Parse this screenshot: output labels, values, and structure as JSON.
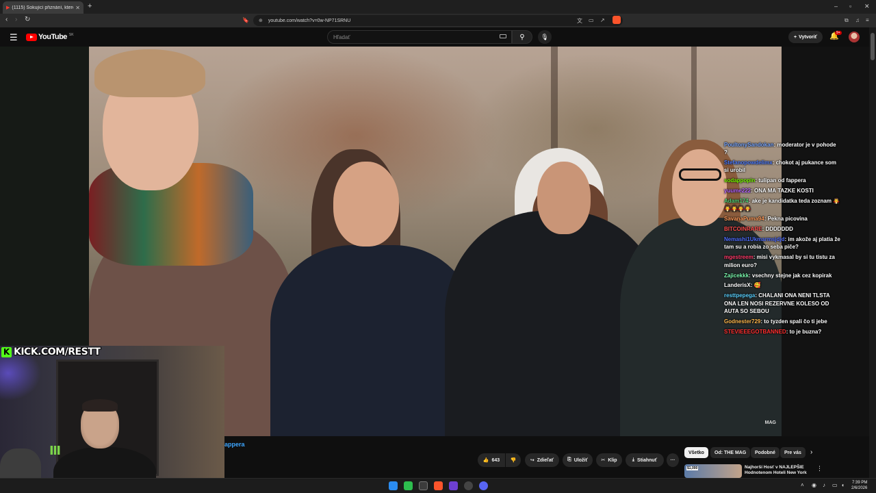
{
  "browser": {
    "tab_title": "(1115) Šokující přiznání, které",
    "new_tab": "+",
    "url": "youtube.com/watch?v=0w-NP71SRNU",
    "window_controls": [
      "–",
      "▫",
      "✕"
    ]
  },
  "youtube": {
    "logo_text": "YouTube",
    "country_code": "SK",
    "search_placeholder": "Hľadať",
    "create_label": "Vytvoriť",
    "notifications_badge": "9+"
  },
  "video": {
    "watermark": "MAG",
    "kick_url": "KICK.COM/RESTT",
    "title_fragment": "appera"
  },
  "chat": [
    {
      "user": "PoultonySandokan",
      "user_color": "#7aa7ff",
      "text": "moderator je v pohode ?"
    },
    {
      "user": "Stefanopowdelimx",
      "user_color": "#4f7dff",
      "text": "chokot aj pukance som si urobil"
    },
    {
      "user": "sodappopin",
      "user_color": "#7cfc00",
      "text": "tulipan od fappera"
    },
    {
      "user": "yuume222",
      "user_color": "#b565ff",
      "text": "ONA MA TAZKE KOSTI"
    },
    {
      "user": "Adam174",
      "user_color": "#54d17a",
      "text": "ake je kandidatka teda zoznam 🧛🧛🧛🧛🧛"
    },
    {
      "user": "SavanaPuma94",
      "user_color": "#ff9a5a",
      "text": "Pekna picovina"
    },
    {
      "user": "BITCOINRARE",
      "user_color": "#ff4d4d",
      "text": "DDDDDDD"
    },
    {
      "user": "Nemashi1Ukmarmsjdjd",
      "user_color": "#4f6dff",
      "text": "im akože aj platia že tam su a robia zo seba piče?"
    },
    {
      "user": "mgestreem",
      "user_color": "#ff3b6a",
      "text": "misi vykmasal by si tu tistu za milion euro?"
    },
    {
      "user": "Zajicekkk",
      "user_color": "#7cfcb0",
      "text": "vsechny stejne jak cez kopirak"
    },
    {
      "user": "LanderisX",
      "user_color": "#ffffff",
      "text": "🥰"
    },
    {
      "user": "resttpepega",
      "user_color": "#5ad1ff",
      "text": "CHALANI ONA NENI TLSTA ONA LEN NOSI REZERVNE KOLESO OD AUTA SO SEBOU"
    },
    {
      "user": "Godnester729",
      "user_color": "#ffb84d",
      "text": "to tyzden spali čo ti jebe"
    },
    {
      "user": "STEVIEEEGOTBANNED",
      "user_color": "#ff3030",
      "text": "to je buzna?"
    }
  ],
  "actions": {
    "like_count": "643",
    "share_label": "Zdieľať",
    "save_label": "Uložiť",
    "clip_label": "Klip",
    "download_label": "Stiahnuť",
    "more_label": "···"
  },
  "chips": [
    "Všetko",
    "Od: THE MAG",
    "Podobné",
    "Pre vás"
  ],
  "recommendation": {
    "badge": "$1,000",
    "title": "Najhorší Hosť v NAJLEPŠIE Hodnotenom Hoteli New York"
  },
  "taskbar": {
    "time": "7:39 PM",
    "date": "2/6/2026"
  },
  "colors": {
    "youtube_red": "#ff0000",
    "kick_green": "#53fc18",
    "link_blue": "#3ea6ff"
  }
}
